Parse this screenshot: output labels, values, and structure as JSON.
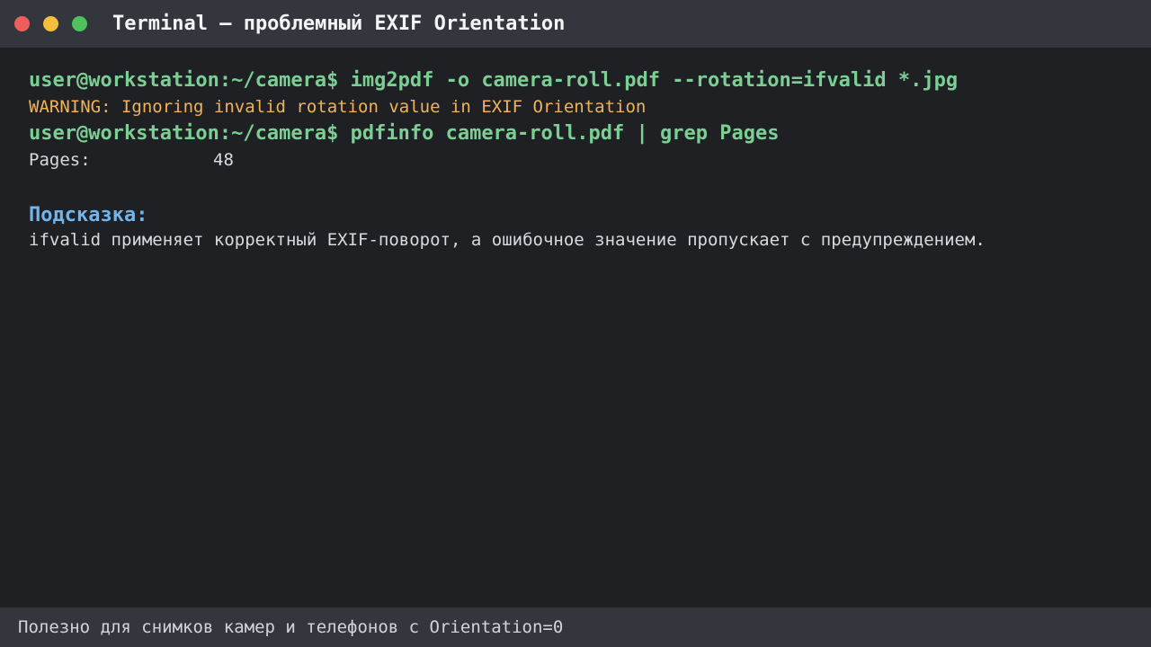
{
  "window": {
    "title": "Terminal — проблемный EXIF Orientation"
  },
  "colors": {
    "command": "#7ccf94",
    "warning": "#f0b35a",
    "hint": "#6fb5ee",
    "background": "#1f2024",
    "bars": "#33363d"
  },
  "terminal": {
    "cmd1": "user@workstation:~/camera$ img2pdf -o camera-roll.pdf --rotation=ifvalid *.jpg",
    "warning": "WARNING: Ignoring invalid rotation value in EXIF Orientation",
    "cmd2": "user@workstation:~/camera$ pdfinfo camera-roll.pdf | grep Pages",
    "pages_label": "Pages:",
    "pages_value": "48",
    "hint_title": "Подсказка:",
    "hint_text": "ifvalid применяет корректный EXIF-поворот, а ошибочное значение пропускает с предупреждением."
  },
  "statusbar": {
    "text": "Полезно для снимков камер и телефонов с Orientation=0"
  }
}
